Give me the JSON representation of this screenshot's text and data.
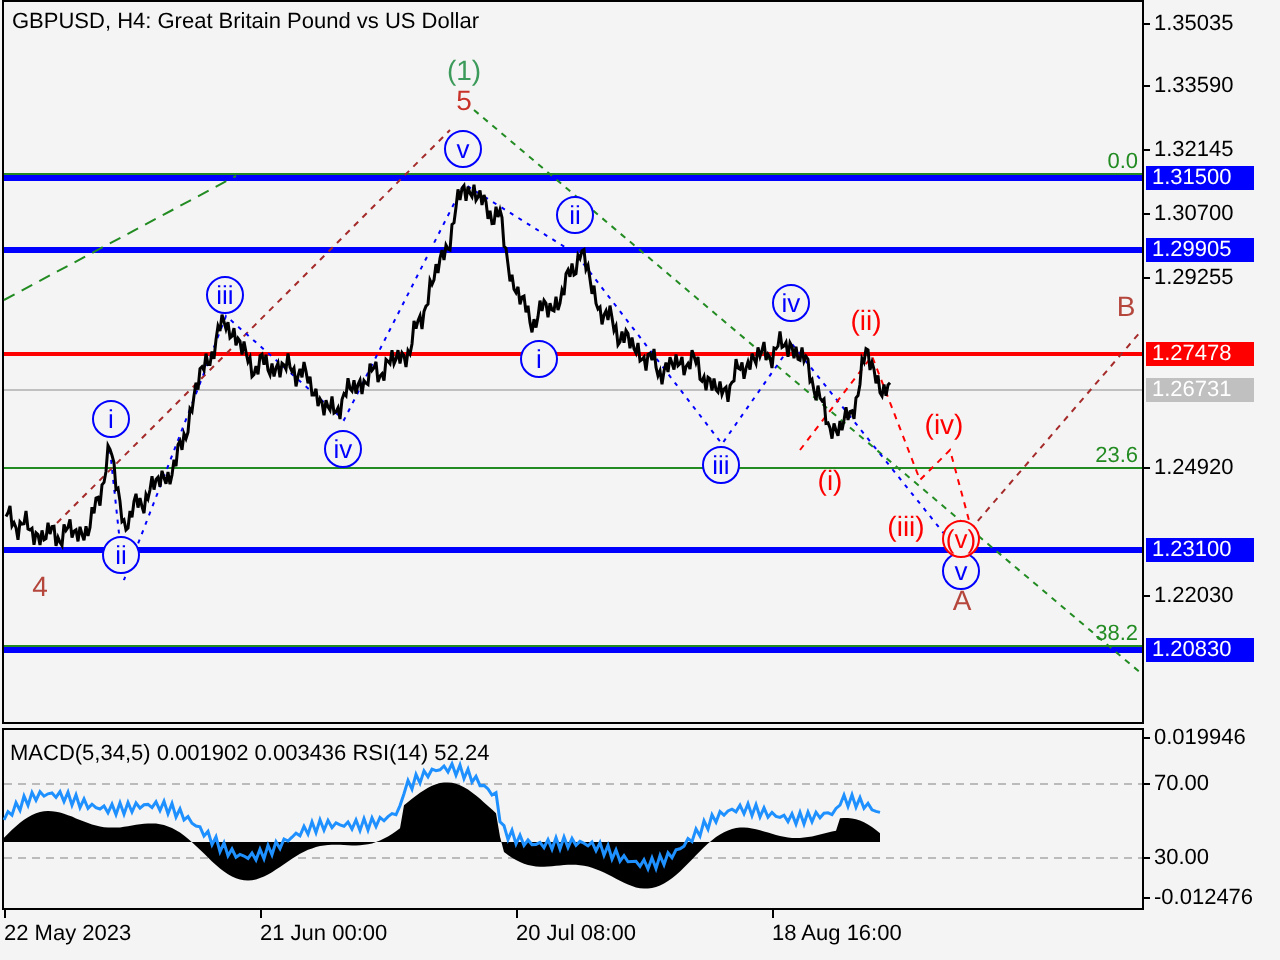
{
  "chart": {
    "title": "GBPUSD, H4:  Great Britain Pound vs US Dollar",
    "price_axis": [
      "1.35035",
      "1.33590",
      "1.32145",
      "1.30700",
      "1.29255",
      "1.24920",
      "1.22030"
    ],
    "levels": [
      {
        "label": "1.31500",
        "color": "#0000ff"
      },
      {
        "label": "1.29905",
        "color": "#0000ff"
      },
      {
        "label": "1.27478",
        "color": "#ff0000"
      },
      {
        "label": "1.26731",
        "color": "#c0c0c0"
      },
      {
        "label": "1.23100",
        "color": "#0000ff"
      },
      {
        "label": "1.20830",
        "color": "#0000ff"
      }
    ],
    "fibo": [
      "0.0",
      "23.6",
      "38.2"
    ],
    "wave_labels": [
      {
        "text": "(1)",
        "color": "#3c9a5a",
        "kind": "plain"
      },
      {
        "text": "5",
        "color": "#c83228",
        "kind": "plain"
      },
      {
        "text": "v",
        "color": "#0000ff",
        "kind": "circled"
      },
      {
        "text": "iii",
        "color": "#0000ff",
        "kind": "circled"
      },
      {
        "text": "i",
        "color": "#0000ff",
        "kind": "circled"
      },
      {
        "text": "ii",
        "color": "#0000ff",
        "kind": "circled"
      },
      {
        "text": "iv",
        "color": "#0000ff",
        "kind": "circled"
      },
      {
        "text": "ii",
        "color": "#0000ff",
        "kind": "circled"
      },
      {
        "text": "i",
        "color": "#0000ff",
        "kind": "circled"
      },
      {
        "text": "iii",
        "color": "#0000ff",
        "kind": "circled"
      },
      {
        "text": "iv",
        "color": "#0000ff",
        "kind": "circled"
      },
      {
        "text": "v",
        "color": "#0000ff",
        "kind": "circled"
      },
      {
        "text": "4",
        "color": "#b4463c",
        "kind": "plain"
      },
      {
        "text": "(ii)",
        "color": "#ff0000",
        "kind": "plain"
      },
      {
        "text": "(i)",
        "color": "#ff0000",
        "kind": "plain"
      },
      {
        "text": "(iv)",
        "color": "#ff0000",
        "kind": "plain"
      },
      {
        "text": "(iii)",
        "color": "#ff0000",
        "kind": "plain"
      },
      {
        "text": "(v)",
        "color": "#ff0000",
        "kind": "circled"
      },
      {
        "text": "A",
        "color": "#b4463c",
        "kind": "plain"
      },
      {
        "text": "B",
        "color": "#b4463c",
        "kind": "plain"
      }
    ]
  },
  "indicator": {
    "title": "MACD(5,34,5) 0.001902 0.003436 RSI(14) 52.24",
    "axis": [
      "0.019946",
      "70.00",
      "30.00",
      "-0.012476"
    ]
  },
  "time_axis": [
    "22 May 2023",
    "21 Jun 00:00",
    "20 Jul 08:00",
    "18 Aug 16:00"
  ]
}
